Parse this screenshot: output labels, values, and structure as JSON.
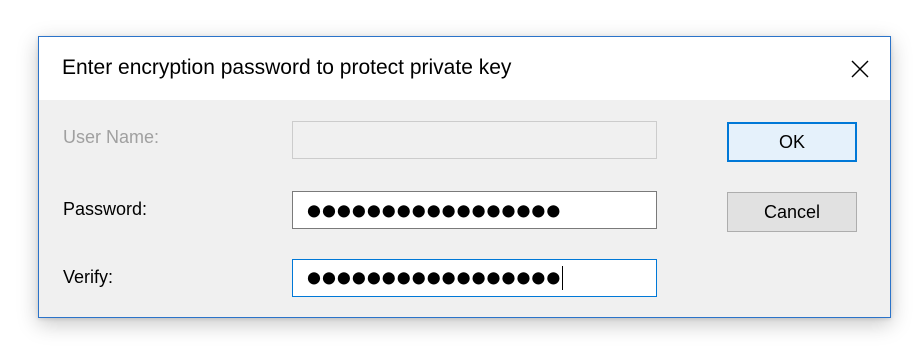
{
  "dialog": {
    "title": "Enter encryption password to protect private key",
    "close_icon": "close-icon"
  },
  "form": {
    "user_name": {
      "label": "User Name:",
      "value": "",
      "enabled": false
    },
    "password": {
      "label": "Password:",
      "value": "●●●●●●●●●●●●●●●●●"
    },
    "verify": {
      "label": "Verify:",
      "value": "●●●●●●●●●●●●●●●●●",
      "focused": true
    }
  },
  "buttons": {
    "ok_label": "OK",
    "cancel_label": "Cancel"
  },
  "colors": {
    "accent": "#0078d7",
    "dialog_border": "#2b73c9",
    "disabled_text": "#a0a0a0"
  }
}
